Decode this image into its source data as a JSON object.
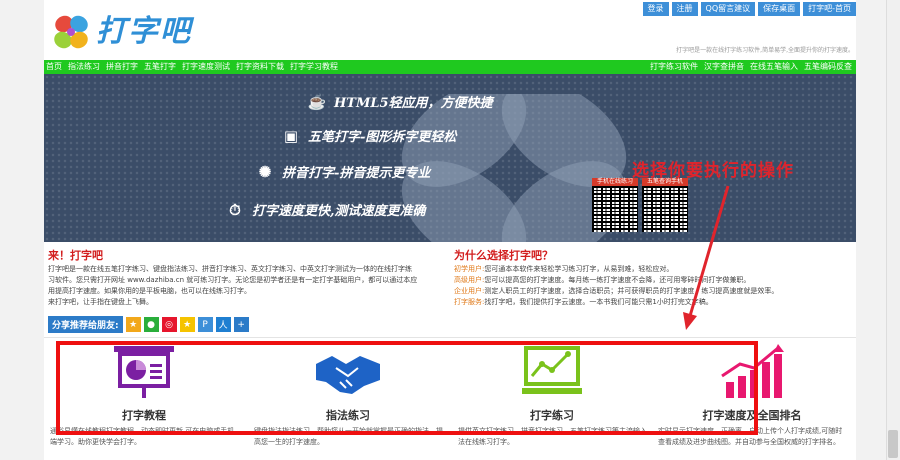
{
  "header": {
    "logo_text": "打字吧",
    "top_links": [
      "登录",
      "注册",
      "QQ留言建议",
      "保存桌面",
      "打字吧-首页"
    ],
    "tagline": "打字吧是一款在线打字练习软件,简单易学,全面提升你的打字速度。"
  },
  "nav": {
    "left": [
      "首页",
      "指法练习",
      "拼音打字",
      "五笔打字",
      "打字速度测试",
      "打字资料下载",
      "打字学习教程"
    ],
    "right": [
      "打字练习软件",
      "汉字查拼音",
      "在线五笔输入",
      "五笔编码反查"
    ]
  },
  "banner": {
    "features": [
      "HTML5轻应用，方便快捷",
      "五笔打字-图形拆字更轻松",
      "拼音打字-拼音提示更专业",
      "打字速度更快,测试速度更准确"
    ],
    "overlay": "选择你要执行的操作",
    "qr": [
      "手机在线练习",
      "五笔查询手机"
    ]
  },
  "intro": {
    "title": "来！打字吧",
    "lines": [
      "打字吧是一款在线五笔打字练习、键盘指法练习、拼音打字练习、英文打字练习、中英文打字测试为一体的在线打字练",
      "习软件。您只需打开网址 www.dazhiba.cn 就可练习打字。无论您是初学者还是有一定打字基础用户，都可以通过本应",
      "用提高打字速度。如果你用的是平板电脑，也可以在线练习打字。",
      "来打字吧，让手指在键盘上飞舞。"
    ]
  },
  "why": {
    "title": "为什么选择打字吧？",
    "items": [
      {
        "k": "初学用户:",
        "v": "您可通本本软件来轻松学习练习打字，从易到难，轻松应对。"
      },
      {
        "k": "高级用户:",
        "v": "您可以提高您的打字速度。每月练一练打字速度不会降，还可用零碎时间打字做兼职。"
      },
      {
        "k": "企业用户:",
        "v": "测定人职员工的打字速度，选择合适职员；并可获得职员的打字速度，练习提高速度就是效率。"
      },
      {
        "k": "打字服务:",
        "v": "找打字吧，我们提供打字云速度。一本书我们可能只需1小时打完文字稿。"
      }
    ]
  },
  "share": {
    "label": "分享推荐给朋友:",
    "buttons": [
      {
        "icon": "star-icon",
        "color": "#f2a81b",
        "glyph": "★"
      },
      {
        "icon": "wechat-icon",
        "color": "#2aae3b",
        "glyph": "●"
      },
      {
        "icon": "weibo-icon",
        "color": "#e6162d",
        "glyph": "◎"
      },
      {
        "icon": "qzone-icon",
        "color": "#f5c300",
        "glyph": "★"
      },
      {
        "icon": "tencent-weibo-icon",
        "color": "#3d8fd8",
        "glyph": "P"
      },
      {
        "icon": "renren-icon",
        "color": "#1f7fd1",
        "glyph": "人"
      },
      {
        "icon": "more-icon",
        "color": "#2c7bc8",
        "glyph": "+"
      }
    ]
  },
  "cards": [
    {
      "title": "打字教程",
      "desc": "通俗易懂在线教程打字教程，动态即时更新,可在电脑或手机端学习。助你更快学会打字。",
      "color": "#7b1fa2"
    },
    {
      "title": "指法练习",
      "desc": "键盘指法指法练习，帮助您从一开始就掌握最正确的指法，提高您一生的打字速度。",
      "color": "#1e63c6"
    },
    {
      "title": "打字练习",
      "desc": "提供英文打字练习、拼音打字练习、五笔打字练习等主流输入法在线练习打字。",
      "color": "#7ac21b"
    },
    {
      "title": "打字速度及全国排名",
      "desc": "实时显示打字速度、正确率，自动上传个人打字成绩,可随时查看成绩及进步曲线图。并自动参与全国权威的打字排名。",
      "color": "#e8186f"
    }
  ]
}
